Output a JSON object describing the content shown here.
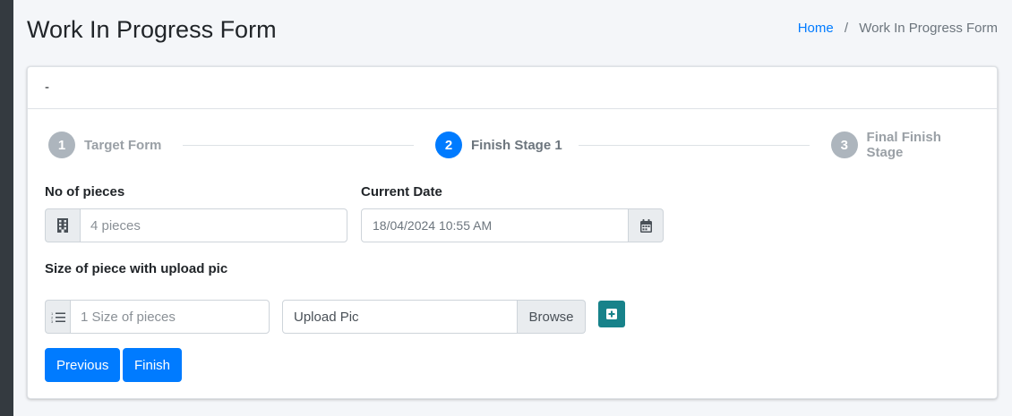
{
  "page": {
    "title": "Work In Progress Form",
    "breadcrumb": {
      "home": "Home",
      "separator": "/",
      "current": "Work In Progress Form"
    }
  },
  "card": {
    "header_text": "-",
    "steps": [
      {
        "number": "1",
        "label": "Target Form",
        "state": "inactive"
      },
      {
        "number": "2",
        "label": "Finish Stage 1",
        "state": "active"
      },
      {
        "number": "3",
        "label": "Final Finish Stage",
        "state": "inactive"
      }
    ],
    "fields": {
      "pieces": {
        "label": "No of pieces",
        "placeholder": "4 pieces",
        "icon": "building-icon"
      },
      "current_date": {
        "label": "Current Date",
        "value": "18/04/2024 10:55 AM",
        "icon": "calendar-icon"
      },
      "size_section_label": "Size of piece with upload pic",
      "size": {
        "placeholder": "1 Size of pieces",
        "icon": "list-icon"
      },
      "upload": {
        "text": "Upload Pic",
        "browse_label": "Browse"
      }
    },
    "buttons": {
      "previous": "Previous",
      "finish": "Finish"
    }
  },
  "colors": {
    "primary": "#007bff",
    "inactive_step": "#adb5bd",
    "add_button": "#17828a",
    "sidebar_strip": "#343a40"
  }
}
